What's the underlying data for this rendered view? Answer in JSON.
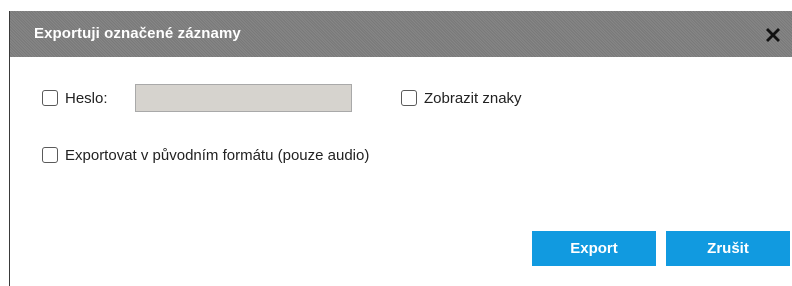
{
  "dialog": {
    "title": "Exportuji označené záznamy",
    "close_icon": "close-x-icon"
  },
  "password": {
    "label": "Heslo:",
    "value": "",
    "placeholder": "",
    "checked": false
  },
  "show_chars": {
    "label": "Zobrazit znaky",
    "checked": false
  },
  "original_format": {
    "label": "Exportovat v původním formátu (pouze audio)",
    "checked": false
  },
  "buttons": {
    "export_label": "Export",
    "cancel_label": "Zrušit"
  },
  "colors": {
    "titlebar": "#7f7f7f",
    "button": "#119ae0"
  }
}
